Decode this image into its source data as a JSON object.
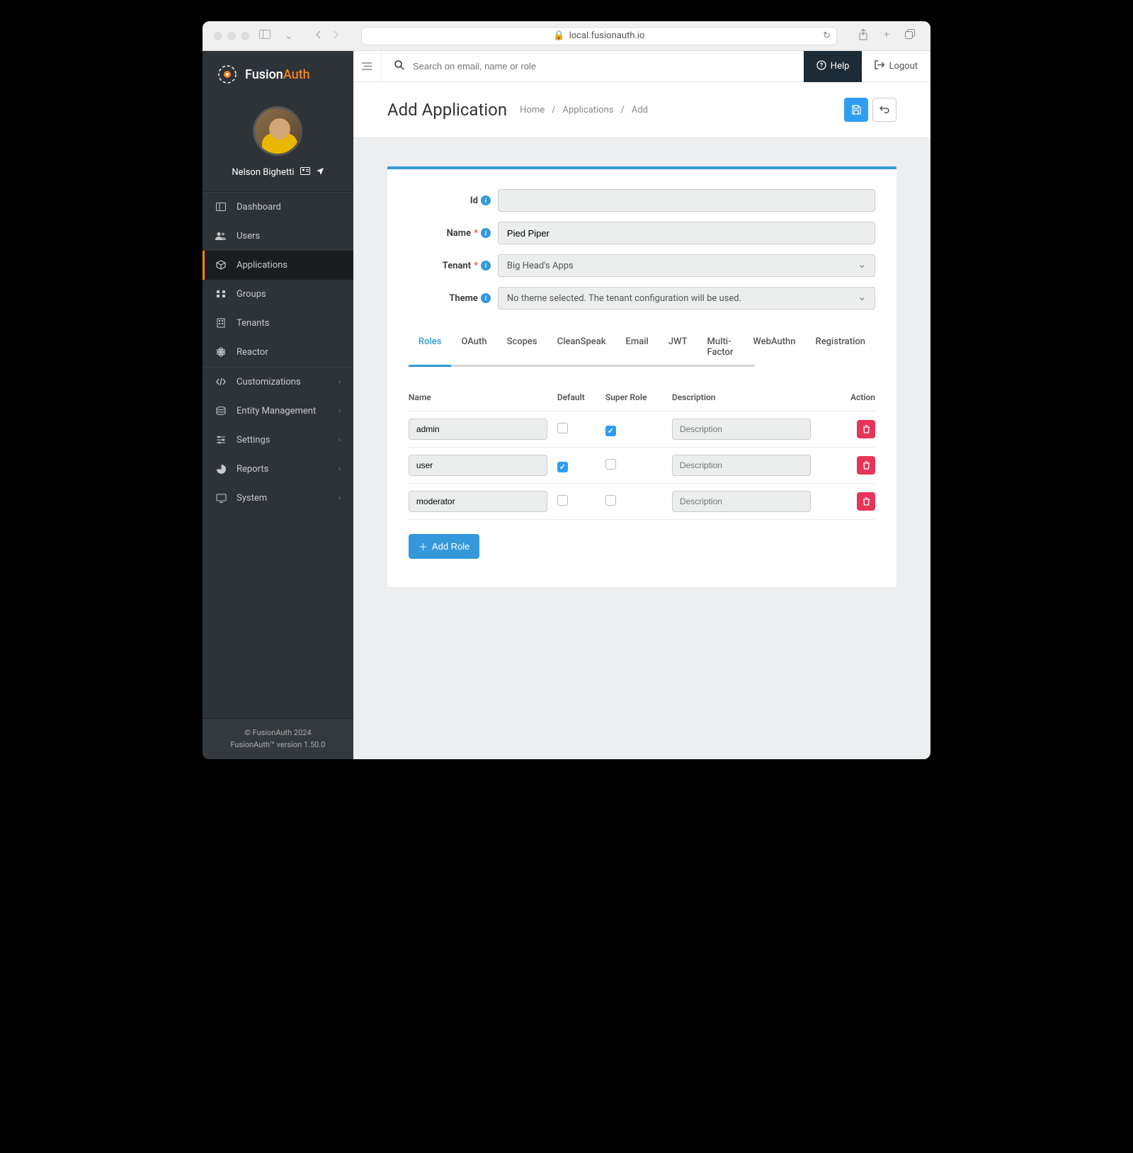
{
  "browser": {
    "url": "local.fusionauth.io"
  },
  "logo": {
    "part1": "Fusion",
    "part2": "Auth"
  },
  "profile": {
    "name": "Nelson Bighetti"
  },
  "nav": {
    "items": [
      {
        "icon": "dashboard-icon",
        "label": "Dashboard",
        "active": false
      },
      {
        "icon": "users-icon",
        "label": "Users",
        "active": false
      },
      {
        "icon": "applications-icon",
        "label": "Applications",
        "active": true
      },
      {
        "icon": "groups-icon",
        "label": "Groups",
        "active": false
      },
      {
        "icon": "tenants-icon",
        "label": "Tenants",
        "active": false
      },
      {
        "icon": "reactor-icon",
        "label": "Reactor",
        "active": false
      }
    ],
    "section2": [
      {
        "icon": "customizations-icon",
        "label": "Customizations",
        "chevron": true
      },
      {
        "icon": "entity-mgmt-icon",
        "label": "Entity Management",
        "chevron": true
      },
      {
        "icon": "settings-icon",
        "label": "Settings",
        "chevron": true
      },
      {
        "icon": "reports-icon",
        "label": "Reports",
        "chevron": true
      },
      {
        "icon": "system-icon",
        "label": "System",
        "chevron": true
      }
    ]
  },
  "footer": {
    "line1": "© FusionAuth 2024",
    "line2": "FusionAuth™ version 1.50.0"
  },
  "topbar": {
    "search_placeholder": "Search on email, name or role",
    "help": "Help",
    "logout": "Logout"
  },
  "page": {
    "title": "Add Application",
    "breadcrumb": [
      "Home",
      "Applications",
      "Add"
    ]
  },
  "form": {
    "id": {
      "label": "Id",
      "value": ""
    },
    "name": {
      "label": "Name",
      "value": "Pied Piper"
    },
    "tenant": {
      "label": "Tenant",
      "value": "Big Head's Apps"
    },
    "theme": {
      "label": "Theme",
      "value": "No theme selected. The tenant configuration will be used."
    }
  },
  "tabs": [
    "Roles",
    "OAuth",
    "Scopes",
    "CleanSpeak",
    "Email",
    "JWT",
    "Multi-Factor",
    "WebAuthn",
    "Registration"
  ],
  "roles": {
    "headers": {
      "name": "Name",
      "default": "Default",
      "super": "Super Role",
      "desc": "Description",
      "action": "Action"
    },
    "desc_placeholder": "Description",
    "rows": [
      {
        "name": "admin",
        "default": false,
        "super": true,
        "desc": ""
      },
      {
        "name": "user",
        "default": true,
        "super": false,
        "desc": ""
      },
      {
        "name": "moderator",
        "default": false,
        "super": false,
        "desc": ""
      }
    ],
    "add_button": "Add Role"
  }
}
